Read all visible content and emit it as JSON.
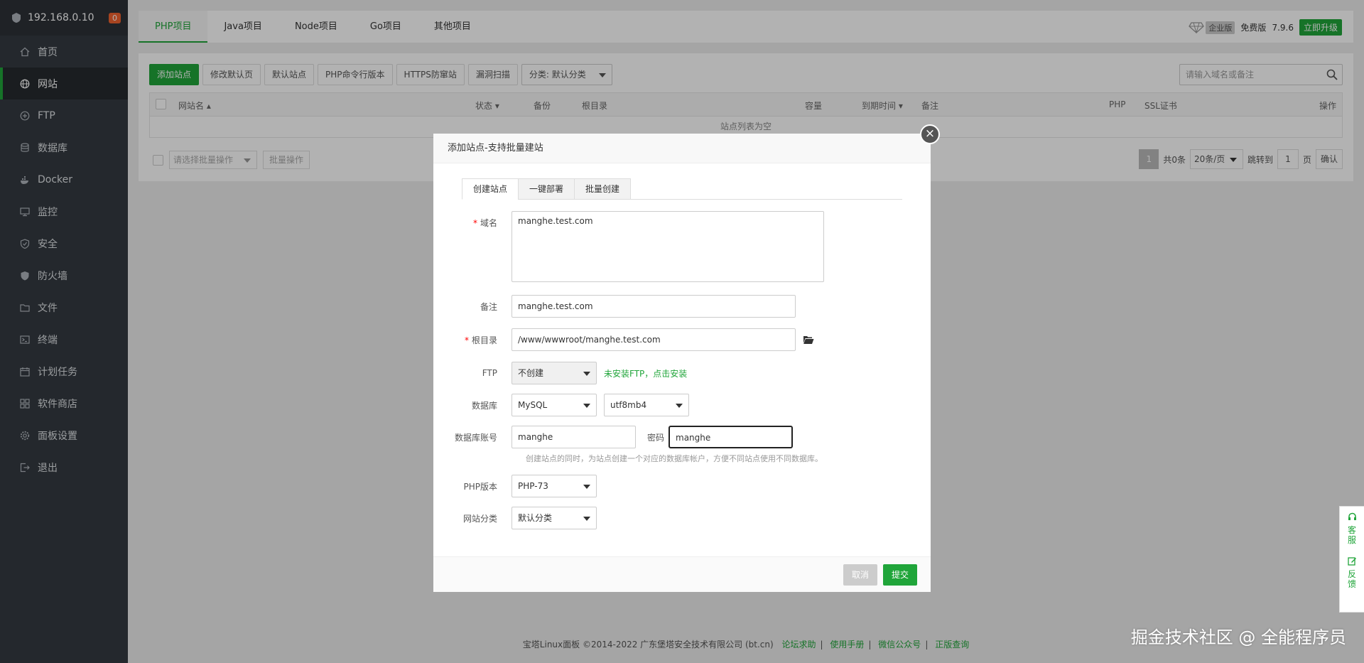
{
  "sidebar": {
    "ip": "192.168.0.10",
    "badge": "0",
    "items": [
      {
        "label": "首页",
        "icon": "home-icon"
      },
      {
        "label": "网站",
        "icon": "globe-icon"
      },
      {
        "label": "FTP",
        "icon": "ftp-icon"
      },
      {
        "label": "数据库",
        "icon": "database-icon"
      },
      {
        "label": "Docker",
        "icon": "docker-icon"
      },
      {
        "label": "监控",
        "icon": "monitor-icon"
      },
      {
        "label": "安全",
        "icon": "shield-icon"
      },
      {
        "label": "防火墙",
        "icon": "firewall-icon"
      },
      {
        "label": "文件",
        "icon": "folder-icon"
      },
      {
        "label": "终端",
        "icon": "terminal-icon"
      },
      {
        "label": "计划任务",
        "icon": "calendar-icon"
      },
      {
        "label": "软件商店",
        "icon": "apps-icon"
      },
      {
        "label": "面板设置",
        "icon": "gear-icon"
      },
      {
        "label": "退出",
        "icon": "logout-icon"
      }
    ]
  },
  "project_tabs": [
    "PHP项目",
    "Java项目",
    "Node项目",
    "Go项目",
    "其他项目"
  ],
  "topright": {
    "enterprise": "企业版",
    "free": "免费版",
    "version": "7.9.6",
    "upgrade": "立即升级"
  },
  "toolbar": {
    "buttons": [
      "添加站点",
      "修改默认页",
      "默认站点",
      "PHP命令行版本",
      "HTTPS防窜站",
      "漏洞扫描"
    ],
    "category": "分类: 默认分类",
    "search_placeholder": "请输入域名或备注"
  },
  "table": {
    "headers": {
      "name": "网站名 ▴",
      "status": "状态 ▾",
      "backup": "备份",
      "root": "根目录",
      "capacity": "容量",
      "expire": "到期时间 ▾",
      "remark": "备注",
      "php": "PHP",
      "ssl": "SSL证书",
      "action": "操作"
    },
    "empty": "站点列表为空"
  },
  "batch": {
    "select": "请选择批量操作",
    "button": "批量操作"
  },
  "pager": {
    "current": "1",
    "total": "共0条",
    "per_page": "20条/页",
    "goto": "跳转到",
    "page_value": "1",
    "page_unit": "页",
    "confirm": "确认"
  },
  "footer": {
    "copyright": "宝塔Linux面板 ©2014-2022 广东堡塔安全技术有限公司 (bt.cn)",
    "links": [
      "论坛求助",
      "使用手册",
      "微信公众号",
      "正版查询"
    ]
  },
  "modal": {
    "title": "添加站点-支持批量建站",
    "tabs": [
      "创建站点",
      "一键部署",
      "批量创建"
    ],
    "domain_label": "域名",
    "domain_value": "manghe.test.com",
    "remark_label": "备注",
    "remark_value": "manghe.test.com",
    "root_label": "根目录",
    "root_value": "/www/wwwroot/manghe.test.com",
    "ftp_label": "FTP",
    "ftp_value": "不创建",
    "ftp_hint": "未安装FTP，点击安装",
    "db_label": "数据库",
    "db_value": "MySQL",
    "charset_value": "utf8mb4",
    "db_account_label": "数据库账号",
    "db_account_value": "manghe",
    "password_label": "密码",
    "password_value": "manghe",
    "db_hint": "创建站点的同时，为站点创建一个对应的数据库帐户，方便不同站点使用不同数据库。",
    "php_label": "PHP版本",
    "php_value": "PHP-73",
    "category_label": "网站分类",
    "category_value": "默认分类",
    "cancel": "取消",
    "submit": "提交"
  },
  "helper": {
    "service": "客服",
    "feedback": "反馈"
  },
  "watermark": "掘金技术社区 @ 全能程序员",
  "colors": {
    "accent": "#20a53a",
    "sidebar": "#343a41"
  }
}
